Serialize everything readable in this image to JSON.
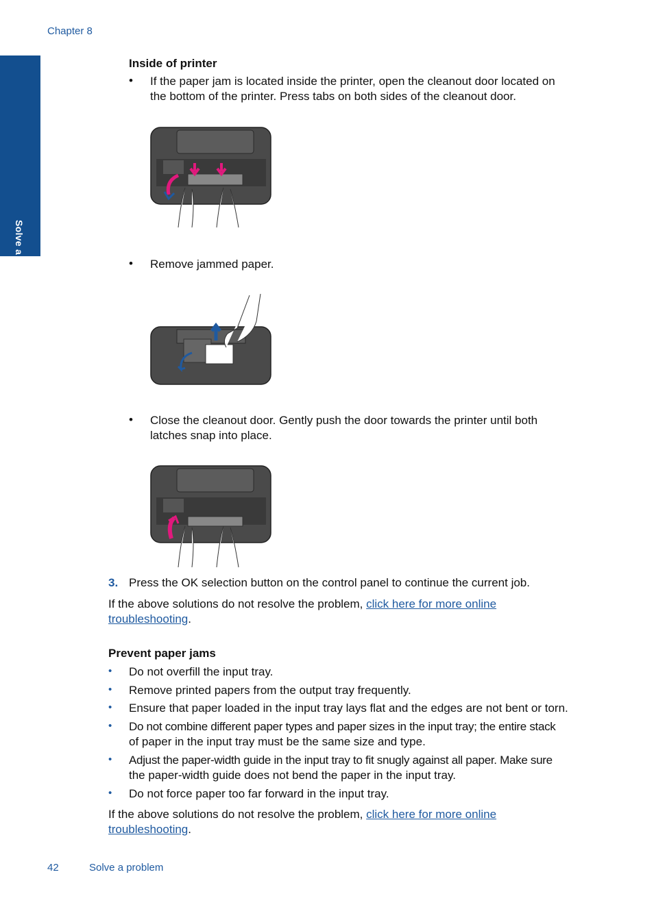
{
  "header": {
    "chapter": "Chapter 8"
  },
  "side_tab": {
    "label": "Solve a problem",
    "color": "#134f8f"
  },
  "section_inside": {
    "heading": "Inside of printer",
    "bullets": [
      {
        "lines": [
          "If the paper jam is located inside the printer, open the cleanout door located on",
          "the bottom of the printer. Press tabs on both sides of the cleanout door."
        ]
      },
      {
        "lines": [
          "Remove jammed paper."
        ]
      },
      {
        "lines": [
          "Close the cleanout door. Gently push the door towards the printer until both",
          "latches snap into place."
        ]
      }
    ],
    "illustrations": [
      {
        "icon": "printer-open-cleanout-door-illustration",
        "arrow_color": "#e0197d"
      },
      {
        "icon": "printer-remove-paper-illustration",
        "arrow_color": "#1f5aa0"
      },
      {
        "icon": "printer-close-cleanout-door-illustration",
        "arrow_color": "#e0197d"
      }
    ]
  },
  "step3": {
    "number": "3.",
    "text": "Press the OK selection button on the control panel to continue the current job."
  },
  "more_help_1": {
    "prefix": "If the above solutions do not resolve the problem, ",
    "link_line1": "click here for more online",
    "link_line2": "troubleshooting",
    "suffix": "."
  },
  "section_prevent": {
    "heading": "Prevent paper jams",
    "bullets": [
      {
        "lines": [
          "Do not overfill the input tray."
        ]
      },
      {
        "lines": [
          "Remove printed papers from the output tray frequently."
        ]
      },
      {
        "lines": [
          "Ensure that paper loaded in the input tray lays flat and the edges are not bent or torn."
        ]
      },
      {
        "lines": [
          "Do not combine different paper types and paper sizes in the input tray; the entire stack",
          "of paper in the input tray must be the same size and type."
        ]
      },
      {
        "lines": [
          "Adjust the paper-width guide in the input tray to fit snugly against all paper. Make sure",
          "the paper-width guide does not bend the paper in the input tray."
        ]
      },
      {
        "lines": [
          "Do not force paper too far forward in the input tray."
        ]
      }
    ]
  },
  "more_help_2": {
    "prefix": "If the above solutions do not resolve the problem, ",
    "link_line1": "click here for more online",
    "link_line2": "troubleshooting",
    "suffix": "."
  },
  "footer": {
    "page_number": "42",
    "title": "Solve a problem"
  },
  "colors": {
    "accent": "#1f5aa0",
    "magenta": "#e0197d"
  }
}
